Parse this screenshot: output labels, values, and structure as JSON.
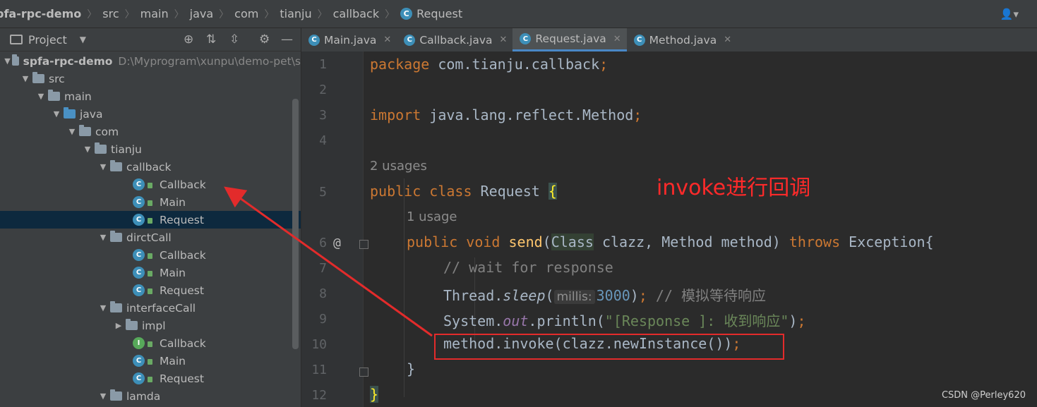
{
  "breadcrumb": {
    "items": [
      "pfa-rpc-demo",
      "src",
      "main",
      "java",
      "com",
      "tianju",
      "callback"
    ],
    "current": "Request",
    "current_icon": "C"
  },
  "project_panel": {
    "title": "Project",
    "tree": [
      {
        "label": "spfa-rpc-demo",
        "path": "D:\\Myprogram\\xunpu\\demo-pet\\s",
        "type": "module",
        "arrow": "▼"
      },
      {
        "label": "src",
        "type": "folder",
        "arrow": "▼"
      },
      {
        "label": "main",
        "type": "folder",
        "arrow": "▼"
      },
      {
        "label": "java",
        "type": "folder-blue",
        "arrow": "▼"
      },
      {
        "label": "com",
        "type": "package",
        "arrow": "▼"
      },
      {
        "label": "tianju",
        "type": "package",
        "arrow": "▼"
      },
      {
        "label": "callback",
        "type": "package",
        "arrow": "▼"
      },
      {
        "label": "Callback",
        "type": "class",
        "icon": "C"
      },
      {
        "label": "Main",
        "type": "class",
        "icon": "C"
      },
      {
        "label": "Request",
        "type": "class",
        "icon": "C",
        "selected": true
      },
      {
        "label": "dirctCall",
        "type": "package",
        "arrow": "▼"
      },
      {
        "label": "Callback",
        "type": "class",
        "icon": "C"
      },
      {
        "label": "Main",
        "type": "class",
        "icon": "C"
      },
      {
        "label": "Request",
        "type": "class",
        "icon": "C"
      },
      {
        "label": "interfaceCall",
        "type": "package",
        "arrow": "▼"
      },
      {
        "label": "impl",
        "type": "package",
        "arrow": "▶"
      },
      {
        "label": "Callback",
        "type": "interface",
        "icon": "I"
      },
      {
        "label": "Main",
        "type": "class",
        "icon": "C"
      },
      {
        "label": "Request",
        "type": "class",
        "icon": "C"
      },
      {
        "label": "lamda",
        "type": "package",
        "arrow": "▼"
      }
    ]
  },
  "tabs": [
    {
      "label": "Main.java",
      "icon": "C",
      "active": false
    },
    {
      "label": "Callback.java",
      "icon": "C",
      "active": false
    },
    {
      "label": "Request.java",
      "icon": "C",
      "active": true
    },
    {
      "label": "Method.java",
      "icon": "C",
      "active": false
    }
  ],
  "editor": {
    "line_numbers": [
      "1",
      "2",
      "3",
      "4",
      "5",
      "6",
      "7",
      "8",
      "9",
      "10",
      "11",
      "12"
    ],
    "override_mark": "@",
    "usages_class": "2 usages",
    "usages_method": "1 usage",
    "code": {
      "l1_kw": "package",
      "l1_rest": " com.tianju.callback",
      "l1_end": ";",
      "l3_kw": "import",
      "l3_rest": " java.lang.reflect.Method",
      "l3_end": ";",
      "l5_kw": "public class",
      "l5_name": " Request ",
      "l5_brace": "{",
      "l6_kw": "public void",
      "l6_fn": "send",
      "l6_p1": "(",
      "l6_class": "Class",
      "l6_p2": " clazz, Method method) ",
      "l6_throws": "throws",
      "l6_p3": " Exception{",
      "l7_comment": "// wait for response",
      "l8_a": "Thread.",
      "l8_fn": "sleep",
      "l8_p": "(",
      "l8_hint": "millis:",
      "l8_num": "3000",
      "l8_b": ")",
      "l8_semi": ";",
      "l8_comment": " // 模拟等待响应",
      "l9_a": "System.",
      "l9_out": "out",
      "l9_b": ".println(",
      "l9_str": "\"[Response ]: 收到响应\"",
      "l9_c": ")",
      "l9_semi": ";",
      "l10_a": "method.invoke(clazz.newInstance())",
      "l10_semi": ";",
      "l11": "}",
      "l12": "}"
    }
  },
  "annotation": {
    "text": "invoke进行回调",
    "color": "#ff2a2a"
  },
  "watermark": "CSDN @Perley620",
  "colors": {
    "keyword": "#cc7832",
    "function": "#ffc66d",
    "string": "#6a8759",
    "number": "#6897bb",
    "comment": "#808080",
    "accent": "#4a88c7"
  }
}
